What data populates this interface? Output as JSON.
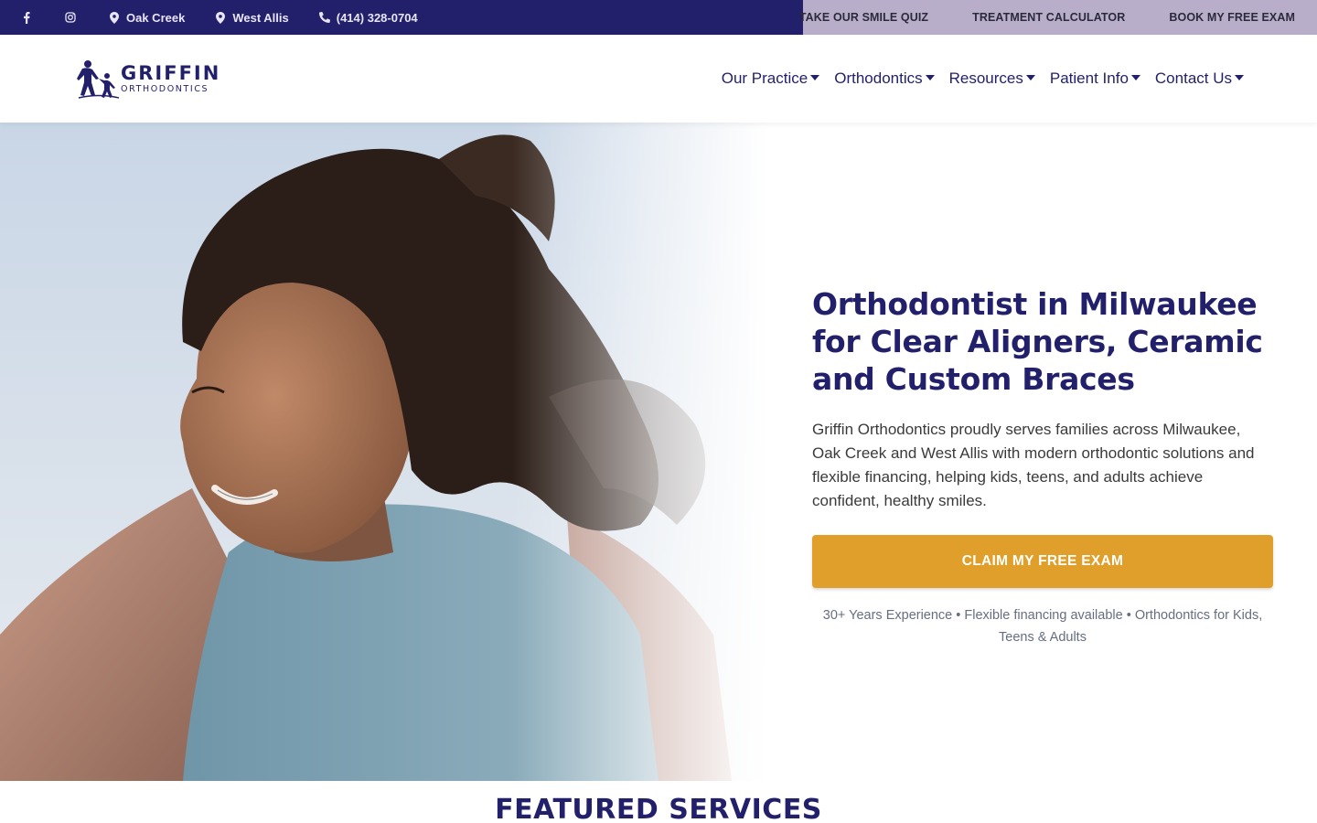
{
  "topbar": {
    "facebook_icon": "facebook-icon",
    "instagram_icon": "instagram-icon",
    "locations": [
      {
        "label": "Oak Creek",
        "icon": "map-pin-icon"
      },
      {
        "label": "West Allis",
        "icon": "map-pin-icon"
      }
    ],
    "phone": {
      "label": "(414) 328-0704",
      "icon": "phone-icon"
    },
    "ctas": [
      "TAKE OUR SMILE QUIZ",
      "TREATMENT CALCULATOR",
      "BOOK MY FREE EXAM"
    ],
    "colors": {
      "left_bg": "#221f6b",
      "right_bg": "#b9aec9"
    }
  },
  "header": {
    "logo": {
      "name": "GRIFFIN",
      "sub": "ORTHODONTICS"
    },
    "nav": [
      "Our Practice",
      "Orthodontics",
      "Resources",
      "Patient Info",
      "Contact Us"
    ]
  },
  "hero": {
    "title": "Orthodontist in Milwaukee for Clear Aligners, Ceramic and Custom Braces",
    "description": "Griffin Orthodontics proudly serves families across Milwaukee, Oak Creek and West Allis with modern orthodontic solutions and flexible financing, helping kids, teens, and adults achieve confident, healthy smiles.",
    "cta": "CLAIM MY FREE EXAM",
    "note": "30+ Years Experience • Flexible financing available • Orthodontics for Kids, Teens & Adults",
    "colors": {
      "brand": "#221f6b",
      "cta": "#e09f2a"
    }
  },
  "featured": {
    "title": "FEATURED SERVICES"
  }
}
